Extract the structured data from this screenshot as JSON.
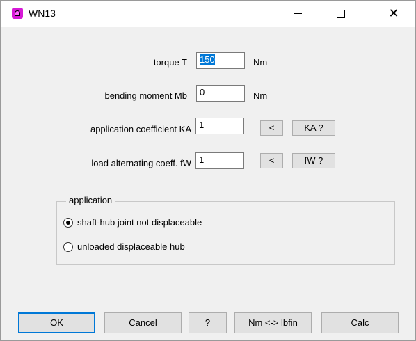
{
  "window": {
    "title": "WN13",
    "controls": {
      "minimize": "—",
      "maximize": "□",
      "close": "✕"
    }
  },
  "fields": [
    {
      "label": "torque T",
      "value": "150",
      "unit": "Nm"
    },
    {
      "label": "bending moment Mb",
      "value": "0",
      "unit": "Nm"
    },
    {
      "label": "application coefficient KA",
      "value": "1",
      "pick": "<",
      "help": "KA  ?"
    },
    {
      "label": "load alternating coeff. fW",
      "value": "1",
      "pick": "<",
      "help": "fW  ?"
    }
  ],
  "application": {
    "title": "application",
    "options": [
      {
        "label": "shaft-hub joint not displaceable",
        "selected": true
      },
      {
        "label": "unloaded displaceable hub",
        "selected": false
      }
    ]
  },
  "buttons": {
    "ok": "OK",
    "cancel": "Cancel",
    "help": "?",
    "convert": "Nm <-> lbfin",
    "calc": "Calc"
  },
  "colors": {
    "accent": "#0078d7",
    "app_icon": "#d619d6"
  }
}
